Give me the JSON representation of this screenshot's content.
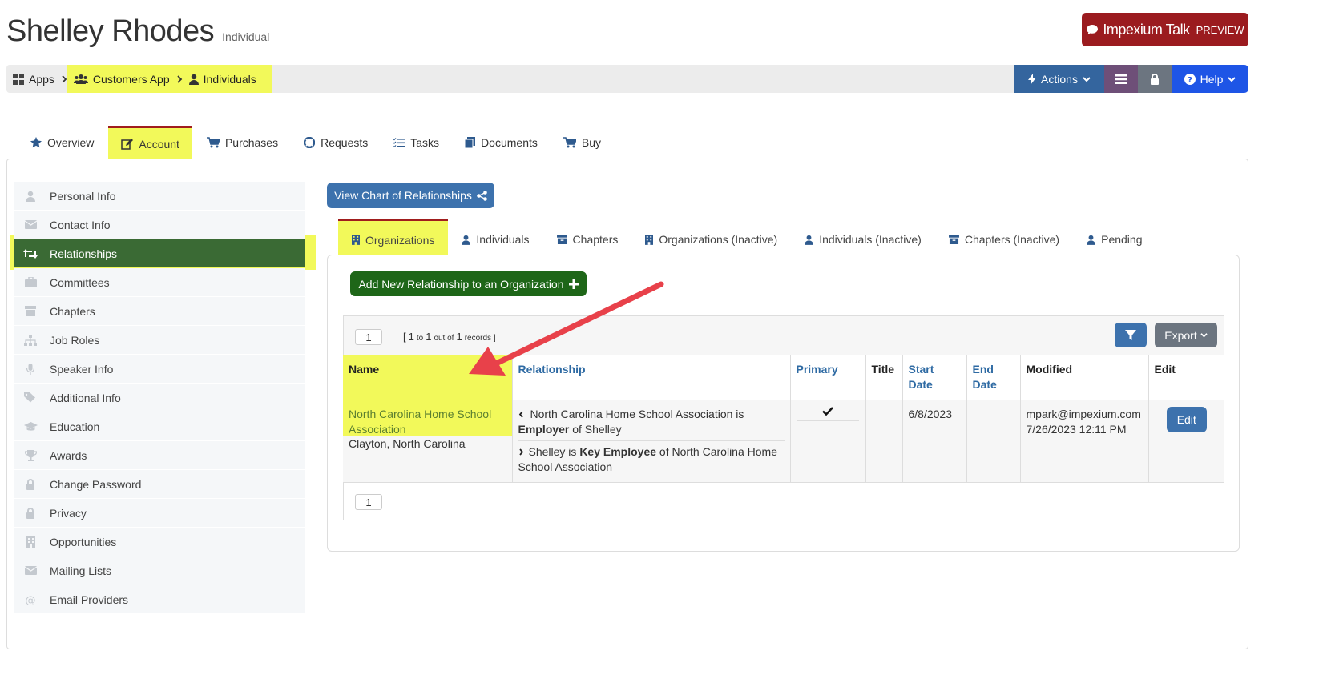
{
  "header": {
    "name": "Shelley Rhodes",
    "type": "Individual",
    "talk_label": "Impexium Talk",
    "talk_preview": "PREVIEW"
  },
  "breadcrumb": {
    "items": [
      "Apps",
      "Customers App",
      "Individuals"
    ]
  },
  "topbar": {
    "actions_label": "Actions",
    "help_label": "Help"
  },
  "main_tabs": [
    "Overview",
    "Account",
    "Purchases",
    "Requests",
    "Tasks",
    "Documents",
    "Buy"
  ],
  "active_main_tab": "Account",
  "sidebar": {
    "items": [
      "Personal Info",
      "Contact Info",
      "Relationships",
      "Committees",
      "Chapters",
      "Job Roles",
      "Speaker Info",
      "Additional Info",
      "Education",
      "Awards",
      "Change Password",
      "Privacy",
      "Opportunities",
      "Mailing Lists",
      "Email Providers"
    ],
    "active": "Relationships"
  },
  "chart_button": "View Chart of Relationships",
  "relationship_tabs": [
    "Organizations",
    "Individuals",
    "Chapters",
    "Organizations (Inactive)",
    "Individuals (Inactive)",
    "Chapters (Inactive)",
    "Pending"
  ],
  "active_relationship_tab": "Organizations",
  "add_button": "Add New Relationship to an Organization",
  "grid": {
    "page": "1",
    "records_open": "[",
    "records_from": "1",
    "records_to_word": "to",
    "records_to": "1",
    "records_outof": "out of",
    "records_total": "1",
    "records_word": "records ]",
    "export_label": "Export",
    "columns": {
      "name": "Name",
      "relationship": "Relationship",
      "primary": "Primary",
      "title": "Title",
      "start_date": "Start Date",
      "end_date": "End Date",
      "modified": "Modified",
      "edit": "Edit"
    },
    "row": {
      "name": "North Carolina Home School Association",
      "location": "Clayton, North Carolina",
      "rel1_pre": "North Carolina Home School Association is",
      "rel1_bold": "Employer",
      "rel1_post": "of Shelley",
      "rel2_pre": "Shelley is",
      "rel2_bold": "Key Employee",
      "rel2_post": "of North Carolina Home School Association",
      "primary": true,
      "title": "",
      "start_date": "6/8/2023",
      "end_date": "",
      "modified_by": "mpark@impexium.com",
      "modified_at": "7/26/2023 12:11 PM",
      "edit_label": "Edit"
    },
    "bottom_page": "1"
  },
  "colors": {
    "highlight": "#f2f95a",
    "active_sidebar": "#3a6a34",
    "primary_blue": "#3d72ad",
    "add_green": "#1e6618",
    "talk_red": "#9b1b1f",
    "arrow_red": "#e8414a"
  }
}
